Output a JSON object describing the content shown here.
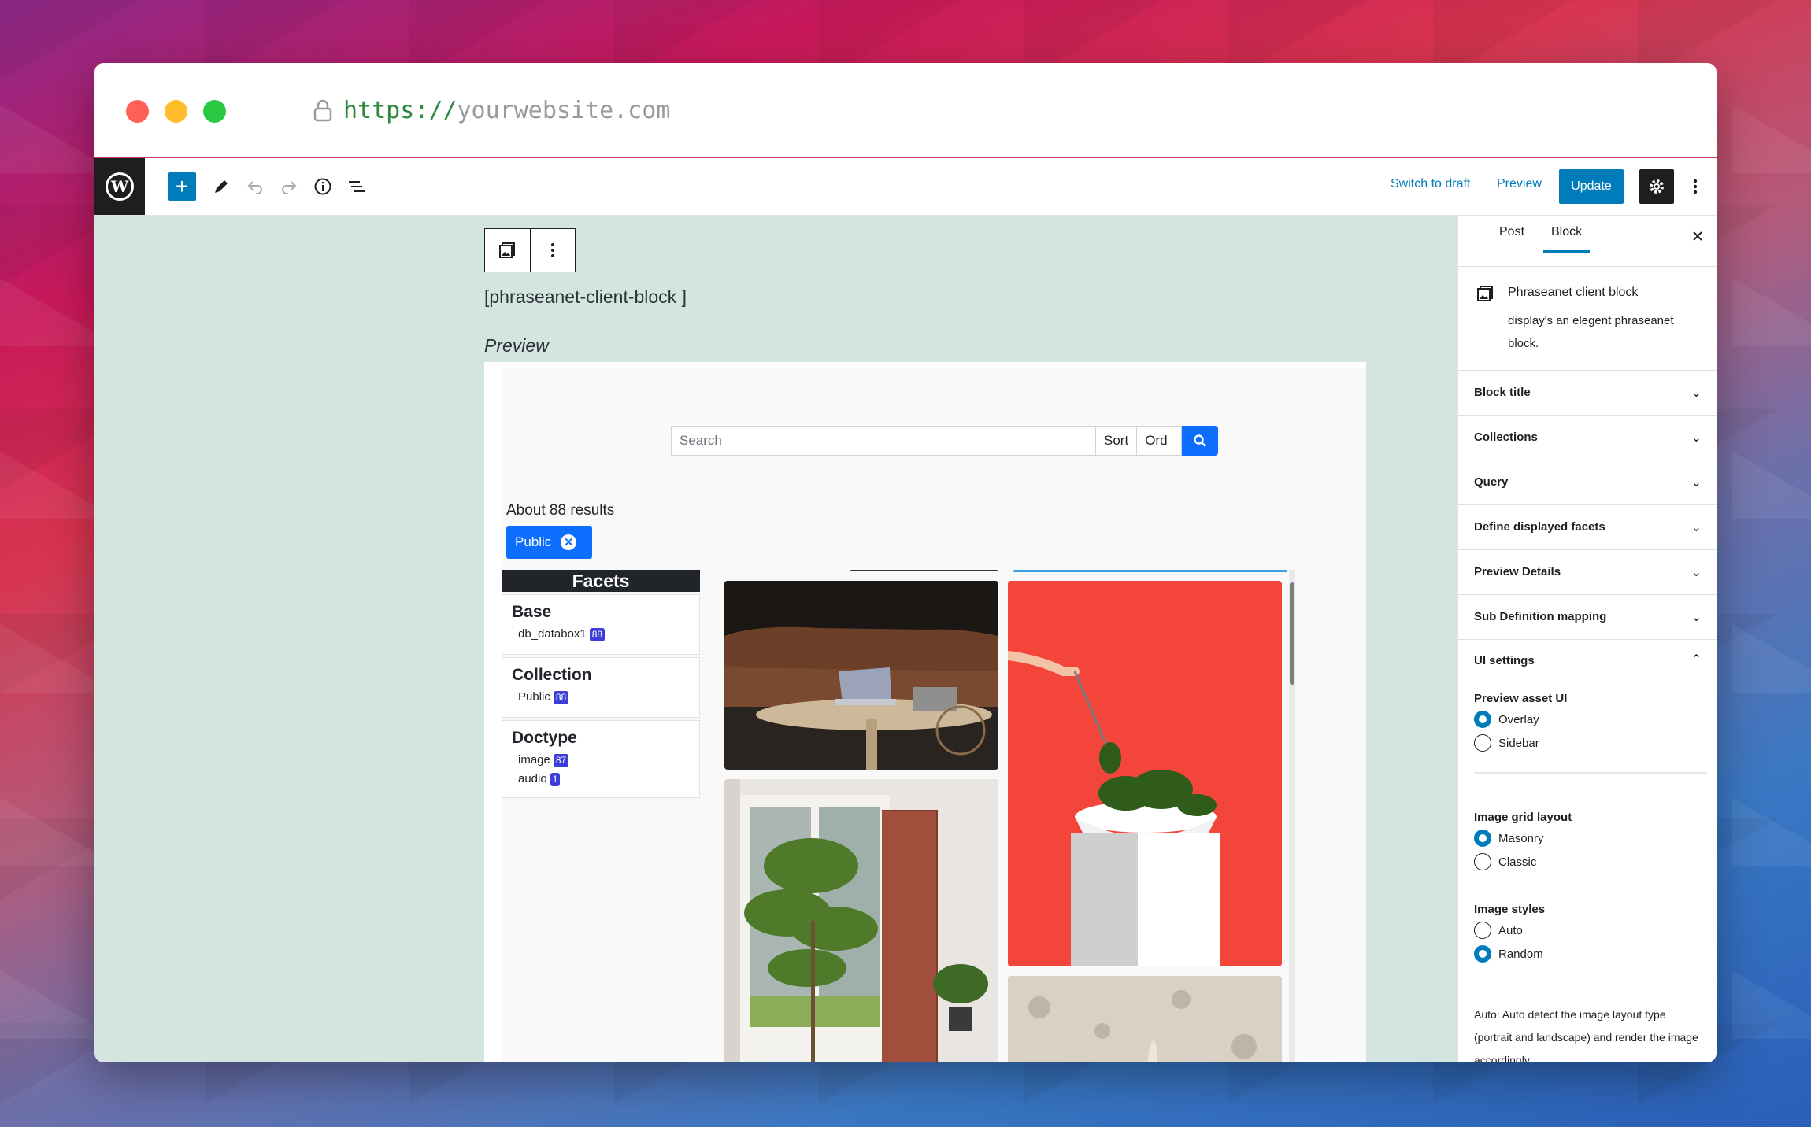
{
  "browser": {
    "url_scheme": "https://",
    "url_host": "yourwebsite.com",
    "colors": {
      "close": "#ff6159",
      "minimize": "#ffbd2e",
      "maximize": "#28c941"
    }
  },
  "toolbar": {
    "wp_logo": "W",
    "add_icon": "+",
    "switch_to_draft": "Switch to draft",
    "preview": "Preview",
    "update": "Update"
  },
  "editor": {
    "shortcode": "[phraseanet-client-block ]",
    "preview_label": "Preview",
    "search": {
      "placeholder": "Search",
      "sort_label": "Sort",
      "order_label": "Ord"
    },
    "results_text": "About 88 results",
    "active_filter": "Public",
    "facets": {
      "heading": "Facets",
      "groups": [
        {
          "title": "Base",
          "items": [
            {
              "label": "db_databox1",
              "count": "88"
            }
          ]
        },
        {
          "title": "Collection",
          "items": [
            {
              "label": "Public",
              "count": "88"
            }
          ]
        },
        {
          "title": "Doctype",
          "items": [
            {
              "label": "image",
              "count": "87"
            },
            {
              "label": "audio",
              "count": "1"
            }
          ]
        }
      ]
    }
  },
  "sidebar": {
    "tabs": [
      "Post",
      "Block"
    ],
    "active_tab": "Block",
    "block_name": "Phraseanet client block",
    "block_desc": "display's an elegent phraseanet block.",
    "panels": [
      "Block title",
      "Collections",
      "Query",
      "Define displayed facets",
      "Preview Details",
      "Sub Definition mapping"
    ],
    "ui_settings": {
      "title": "UI settings",
      "preview_asset_ui": {
        "label": "Preview asset UI",
        "options": [
          "Overlay",
          "Sidebar"
        ],
        "selected": "Overlay"
      },
      "image_grid_layout": {
        "label": "Image grid layout",
        "options": [
          "Masonry",
          "Classic"
        ],
        "selected": "Masonry"
      },
      "image_styles": {
        "label": "Image styles",
        "options": [
          "Auto",
          "Random"
        ],
        "selected": "Random"
      },
      "help_text": "Auto: Auto detect the image layout type (portrait and landscape) and render the image accordingly"
    }
  },
  "colors": {
    "wp_blue": "#007cba",
    "bs_blue": "#0d6efd",
    "editor_bg": "#d4e4de"
  }
}
